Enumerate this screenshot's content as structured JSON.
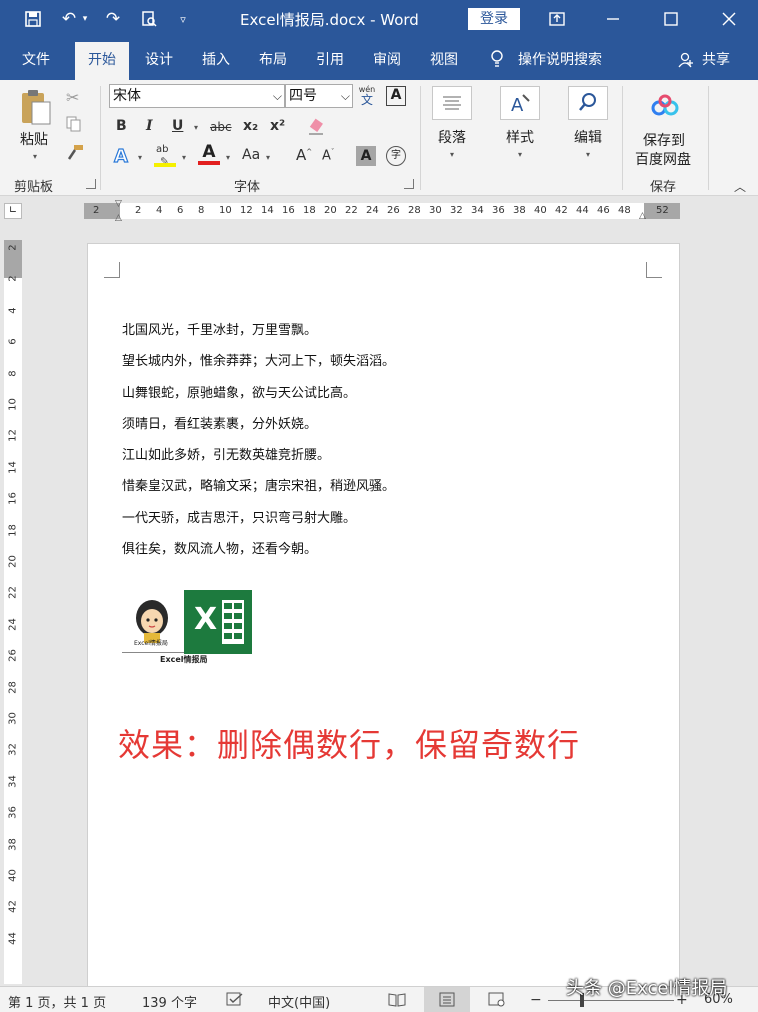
{
  "app": {
    "title": "Excel情报局.docx - Word",
    "login_label": "登录"
  },
  "tabs": [
    {
      "label": "文件"
    },
    {
      "label": "开始"
    },
    {
      "label": "设计"
    },
    {
      "label": "插入"
    },
    {
      "label": "布局"
    },
    {
      "label": "引用"
    },
    {
      "label": "审阅"
    },
    {
      "label": "视图"
    }
  ],
  "tell_me": {
    "label": "操作说明搜索"
  },
  "share": {
    "label": "共享"
  },
  "ribbon": {
    "clipboard": {
      "paste_label": "粘贴",
      "group_label": "剪贴板"
    },
    "font": {
      "font_name": "宋体",
      "font_size": "四号",
      "phonetic_label": "wén",
      "phonetic_char": "文",
      "border_char": "A",
      "group_label": "字体",
      "bold": "B",
      "italic": "I",
      "underline": "U",
      "strike": "abc",
      "subscript": "x₂",
      "superscript": "x²",
      "grow": "A",
      "shrink": "A",
      "change_case": "Aa",
      "char_shading": "A",
      "enclose": "字"
    },
    "paragraph": {
      "label": "段落"
    },
    "styles": {
      "label": "样式"
    },
    "editing": {
      "label": "编辑"
    },
    "baidu": {
      "line1": "保存到",
      "line2": "百度网盘",
      "group_label": "保存"
    }
  },
  "ruler": {
    "h_ticks": [
      "2",
      "2",
      "4",
      "6",
      "8",
      "10",
      "12",
      "14",
      "16",
      "18",
      "20",
      "22",
      "24",
      "26",
      "28",
      "30",
      "32",
      "34",
      "36",
      "38",
      "40",
      "42",
      "44",
      "46",
      "48",
      "52"
    ],
    "v_ticks": [
      "2",
      "2",
      "4",
      "6",
      "8",
      "10",
      "12",
      "14",
      "16",
      "18",
      "20",
      "22",
      "24",
      "26",
      "28",
      "30",
      "32",
      "34",
      "36",
      "38",
      "40",
      "42",
      "44"
    ]
  },
  "document": {
    "poem_lines": [
      "北国风光，千里冰封，万里雪飘。",
      "望长城内外，惟余莽莽；大河上下，顿失滔滔。",
      "山舞银蛇，原驰蜡象，欲与天公试比高。",
      "须晴日，看红装素裹，分外妖娆。",
      "江山如此多娇，引无数英雄竞折腰。",
      "惜秦皇汉武，略输文采；唐宗宋祖，稍逊风骚。",
      "一代天骄，成吉思汗，只识弯弓射大雕。",
      "俱往矣，数风流人物，还看今朝。"
    ],
    "logo_caption": "Excel情报局",
    "logo_badge": "Excel情报局",
    "excel_letter": "X",
    "result_text": "效果：删除偶数行，保留奇数行"
  },
  "statusbar": {
    "page": "第 1 页，共 1 页",
    "words": "139 个字",
    "language": "中文(中国)",
    "zoom": "60%"
  },
  "watermark": "头条 @Excel情报局",
  "colors": {
    "brand": "#2b579a",
    "result": "#e53935",
    "excel_green": "#1d7a3e"
  }
}
